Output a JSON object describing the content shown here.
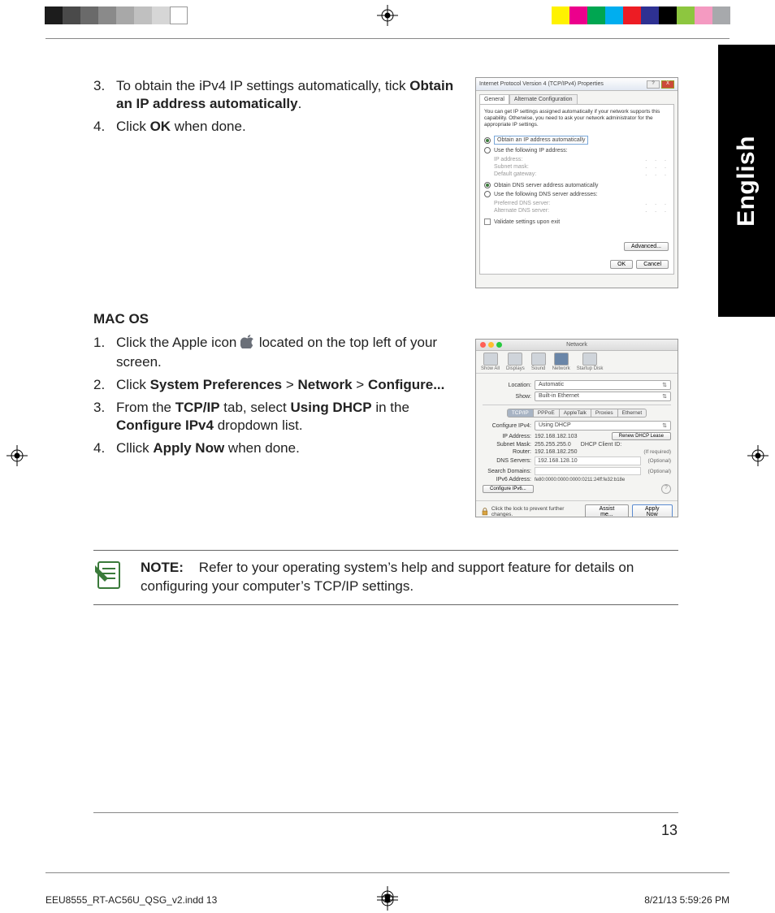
{
  "language_tab": "English",
  "steps_windows": {
    "start_number": 3,
    "items": [
      {
        "num": "3.",
        "pre": "To obtain the iPv4 IP settings automatically, tick ",
        "bold": "Obtain an IP address automatically",
        "post": "."
      },
      {
        "num": "4.",
        "pre": "Click ",
        "bold": "OK",
        "post": " when done."
      }
    ]
  },
  "mac_heading": "MAC OS",
  "steps_mac": [
    {
      "num": "1.",
      "segments": [
        {
          "t": "Click the Apple icon "
        },
        {
          "icon": "apple"
        },
        {
          "t": " located on the top left of your screen."
        }
      ]
    },
    {
      "num": "2.",
      "segments": [
        {
          "t": "Click "
        },
        {
          "b": "System Preferences"
        },
        {
          "t": " > "
        },
        {
          "b": "Network"
        },
        {
          "t": " > "
        },
        {
          "b": "Configure..."
        }
      ]
    },
    {
      "num": "3.",
      "segments": [
        {
          "t": "From the "
        },
        {
          "b": "TCP/IP"
        },
        {
          "t": " tab, select "
        },
        {
          "b": "Using DHCP"
        },
        {
          "t": " in the "
        },
        {
          "b": "Configure IPv4"
        },
        {
          "t": " dropdown list."
        }
      ]
    },
    {
      "num": "4.",
      "segments": [
        {
          "t": "Cllick "
        },
        {
          "b": "Apply Now"
        },
        {
          "t": " when done."
        }
      ]
    }
  ],
  "note": {
    "label": "NOTE:",
    "text": "Refer to your operating system’s help and support feature for details on configuring your computer’s TCP/IP settings."
  },
  "page_number": "13",
  "slug_left": "EEU8555_RT-AC56U_QSG_v2.indd   13",
  "slug_right": "8/21/13   5:59:26 PM",
  "win_dialog": {
    "title": "Internet Protocol Version 4 (TCP/IPv4) Properties",
    "tabs": [
      "General",
      "Alternate Configuration"
    ],
    "desc": "You can get IP settings assigned automatically if your network supports this capability. Otherwise, you need to ask your network administrator for the appropriate IP settings.",
    "opt_auto_ip": "Obtain an IP address automatically",
    "opt_use_ip": "Use the following IP address:",
    "lbl_ip": "IP address:",
    "lbl_mask": "Subnet mask:",
    "lbl_gw": "Default gateway:",
    "opt_auto_dns": "Obtain DNS server address automatically",
    "opt_use_dns": "Use the following DNS server addresses:",
    "lbl_pref_dns": "Preferred DNS server:",
    "lbl_alt_dns": "Alternate DNS server:",
    "chk_validate": "Validate settings upon exit",
    "btn_adv": "Advanced...",
    "btn_ok": "OK",
    "btn_cancel": "Cancel"
  },
  "mac_dialog": {
    "title": "Network",
    "toolbar": [
      "Show All",
      "Displays",
      "Sound",
      "Network",
      "Startup Disk"
    ],
    "lbl_location": "Location:",
    "val_location": "Automatic",
    "lbl_show": "Show:",
    "val_show": "Built-in Ethernet",
    "tabs": [
      "TCP/IP",
      "PPPoE",
      "AppleTalk",
      "Proxies",
      "Ethernet"
    ],
    "lbl_conf": "Configure IPv4:",
    "val_conf": "Using DHCP",
    "lbl_ip": "IP Address:",
    "val_ip": "192.168.182.103",
    "btn_renew": "Renew DHCP Lease",
    "lbl_mask": "Subnet Mask:",
    "val_mask": "255.255.255.0",
    "lbl_client": "DHCP Client ID:",
    "hint_req": "(If required)",
    "lbl_router": "Router:",
    "val_router": "192.168.182.250",
    "lbl_dns": "DNS Servers:",
    "val_dns": "192.168.128.10",
    "hint_opt": "(Optional)",
    "lbl_search": "Search Domains:",
    "lbl_v6": "IPv6 Address:",
    "val_v6": "fe80:0000:0000:0000:0211:24ff:fe32:b18e",
    "btn_conf_v6": "Configure IPv6...",
    "foot_lock": "Click the lock to prevent further changes.",
    "btn_assist": "Assist me...",
    "btn_apply": "Apply Now"
  },
  "colorbars": {
    "gray_steps": [
      "#1c1c1c",
      "#4a4a4a",
      "#6a6a6a",
      "#8a8a8a",
      "#a8a8a8",
      "#c0c0c0",
      "#d6d6d6",
      "#ffffff"
    ],
    "colors": [
      "#fff200",
      "#ec008c",
      "#00a651",
      "#00aeef",
      "#ed1c24",
      "#2e3192",
      "#000000",
      "#8dc63f",
      "#f49ac1",
      "#a7a9ac"
    ]
  }
}
